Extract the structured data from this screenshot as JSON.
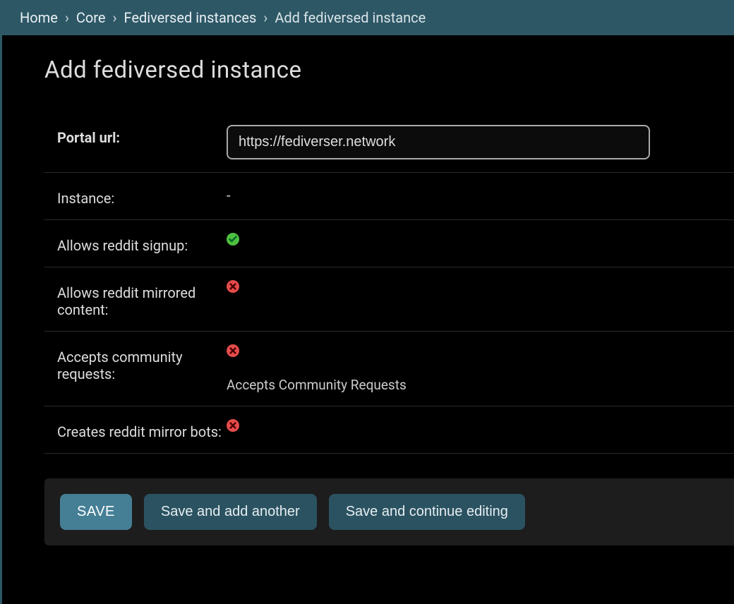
{
  "breadcrumb": {
    "items": [
      {
        "label": "Home"
      },
      {
        "label": "Core"
      },
      {
        "label": "Fediversed instances"
      }
    ],
    "current": "Add fediversed instance"
  },
  "page_title": "Add fediversed instance",
  "fields": {
    "portal_url": {
      "label": "Portal url:",
      "value": "https://fediverser.network"
    },
    "instance": {
      "label": "Instance:",
      "value": "-"
    },
    "allows_reddit_signup": {
      "label": "Allows reddit signup:",
      "value": true
    },
    "allows_reddit_mirrored_content": {
      "label": "Allows reddit mirrored content:",
      "value": false
    },
    "accepts_community_requests": {
      "label": "Accepts community requests:",
      "value": false,
      "help": "Accepts Community Requests"
    },
    "creates_reddit_mirror_bots": {
      "label": "Creates reddit mirror bots:",
      "value": false
    }
  },
  "buttons": {
    "save": "Save",
    "save_add": "Save and add another",
    "save_continue": "Save and continue editing"
  }
}
